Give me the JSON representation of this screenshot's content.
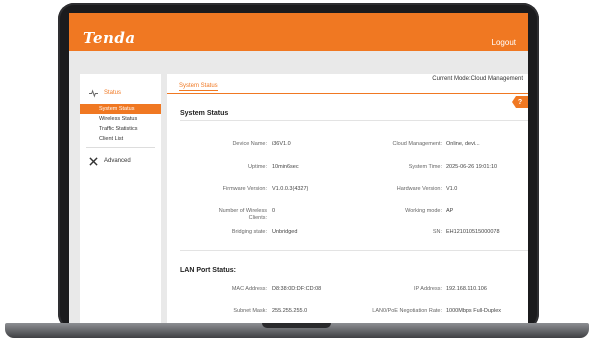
{
  "header": {
    "logo": "Tenda",
    "logout": "Logout"
  },
  "sidebar": {
    "groups": [
      {
        "label": "Status",
        "icon": "pulse-icon",
        "items": [
          "System Status",
          "Wireless Status",
          "Traffic Statistics",
          "Client List"
        ]
      },
      {
        "label": "Advanced",
        "icon": "tools-icon"
      }
    ],
    "active_item": "System Status"
  },
  "content": {
    "tab": "System Status",
    "mode": "Current Mode:Cloud Management",
    "help": "?",
    "system": {
      "title": "System Status",
      "rows": [
        {
          "l1": "Device Name:",
          "v1": "i36V1.0",
          "l2": "Cloud Management:",
          "v2": "Online, devi..."
        },
        {
          "l1": "Uptime:",
          "v1": "10min6sec",
          "l2": "System Time:",
          "v2": "2025-06-26 19:01:10"
        },
        {
          "l1": "Firmware Version:",
          "v1": "V1.0.0.3(4327)",
          "l2": "Hardware Version:",
          "v2": "V1.0"
        },
        {
          "l1": "Number of Wireless Clients:",
          "v1": "0",
          "l2": "Working mode:",
          "v2": "AP"
        },
        {
          "l1": "Bridging state:",
          "v1": "Unbridged",
          "l2": "SN:",
          "v2": "EH121010515000078"
        }
      ]
    },
    "lan": {
      "title": "LAN Port Status:",
      "rows": [
        {
          "l1": "MAC Address:",
          "v1": "D8:38:0D:DF:CD:08",
          "l2": "IP Address:",
          "v2": "192.168.110.106"
        },
        {
          "l1": "Subnet Mask:",
          "v1": "255.255.255.0",
          "l2": "LAN0/PoE Negotiation Rate:",
          "v2": "1000Mbps Full-Duplex"
        }
      ]
    }
  },
  "colors": {
    "accent": "#f07822",
    "frame": "#1b1b1d",
    "screen_bg": "#e9e9e9"
  }
}
